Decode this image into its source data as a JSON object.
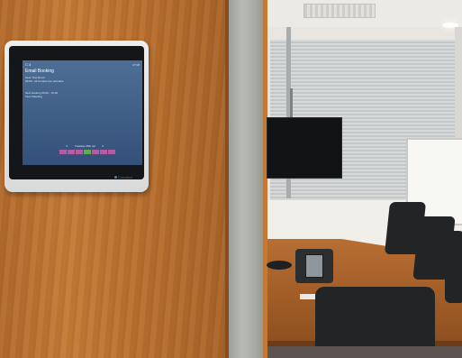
{
  "tablet": {
    "status": "C.4",
    "time": "07:08",
    "title": "Email Booking",
    "line1": "Next: Test Room",
    "line2": "09:00 - All Conference schedule",
    "line3": "Next booking 09:00 - 10:00",
    "line4": "Team Meeting",
    "date_label": "Tuesday 25th Jul",
    "nav_prev": "<",
    "nav_next": ">",
    "slot_colors": {
      "booked": "#b45ca3",
      "free": "#5fae4e"
    },
    "slots": [
      "booked",
      "booked",
      "booked",
      "free",
      "booked",
      "booked",
      "booked"
    ],
    "brand": "Condeco"
  },
  "scene": {
    "description_icons": [
      "wall-tablet",
      "tv-screen",
      "flipchart",
      "conference-phone",
      "meeting-table",
      "office-chairs"
    ]
  }
}
